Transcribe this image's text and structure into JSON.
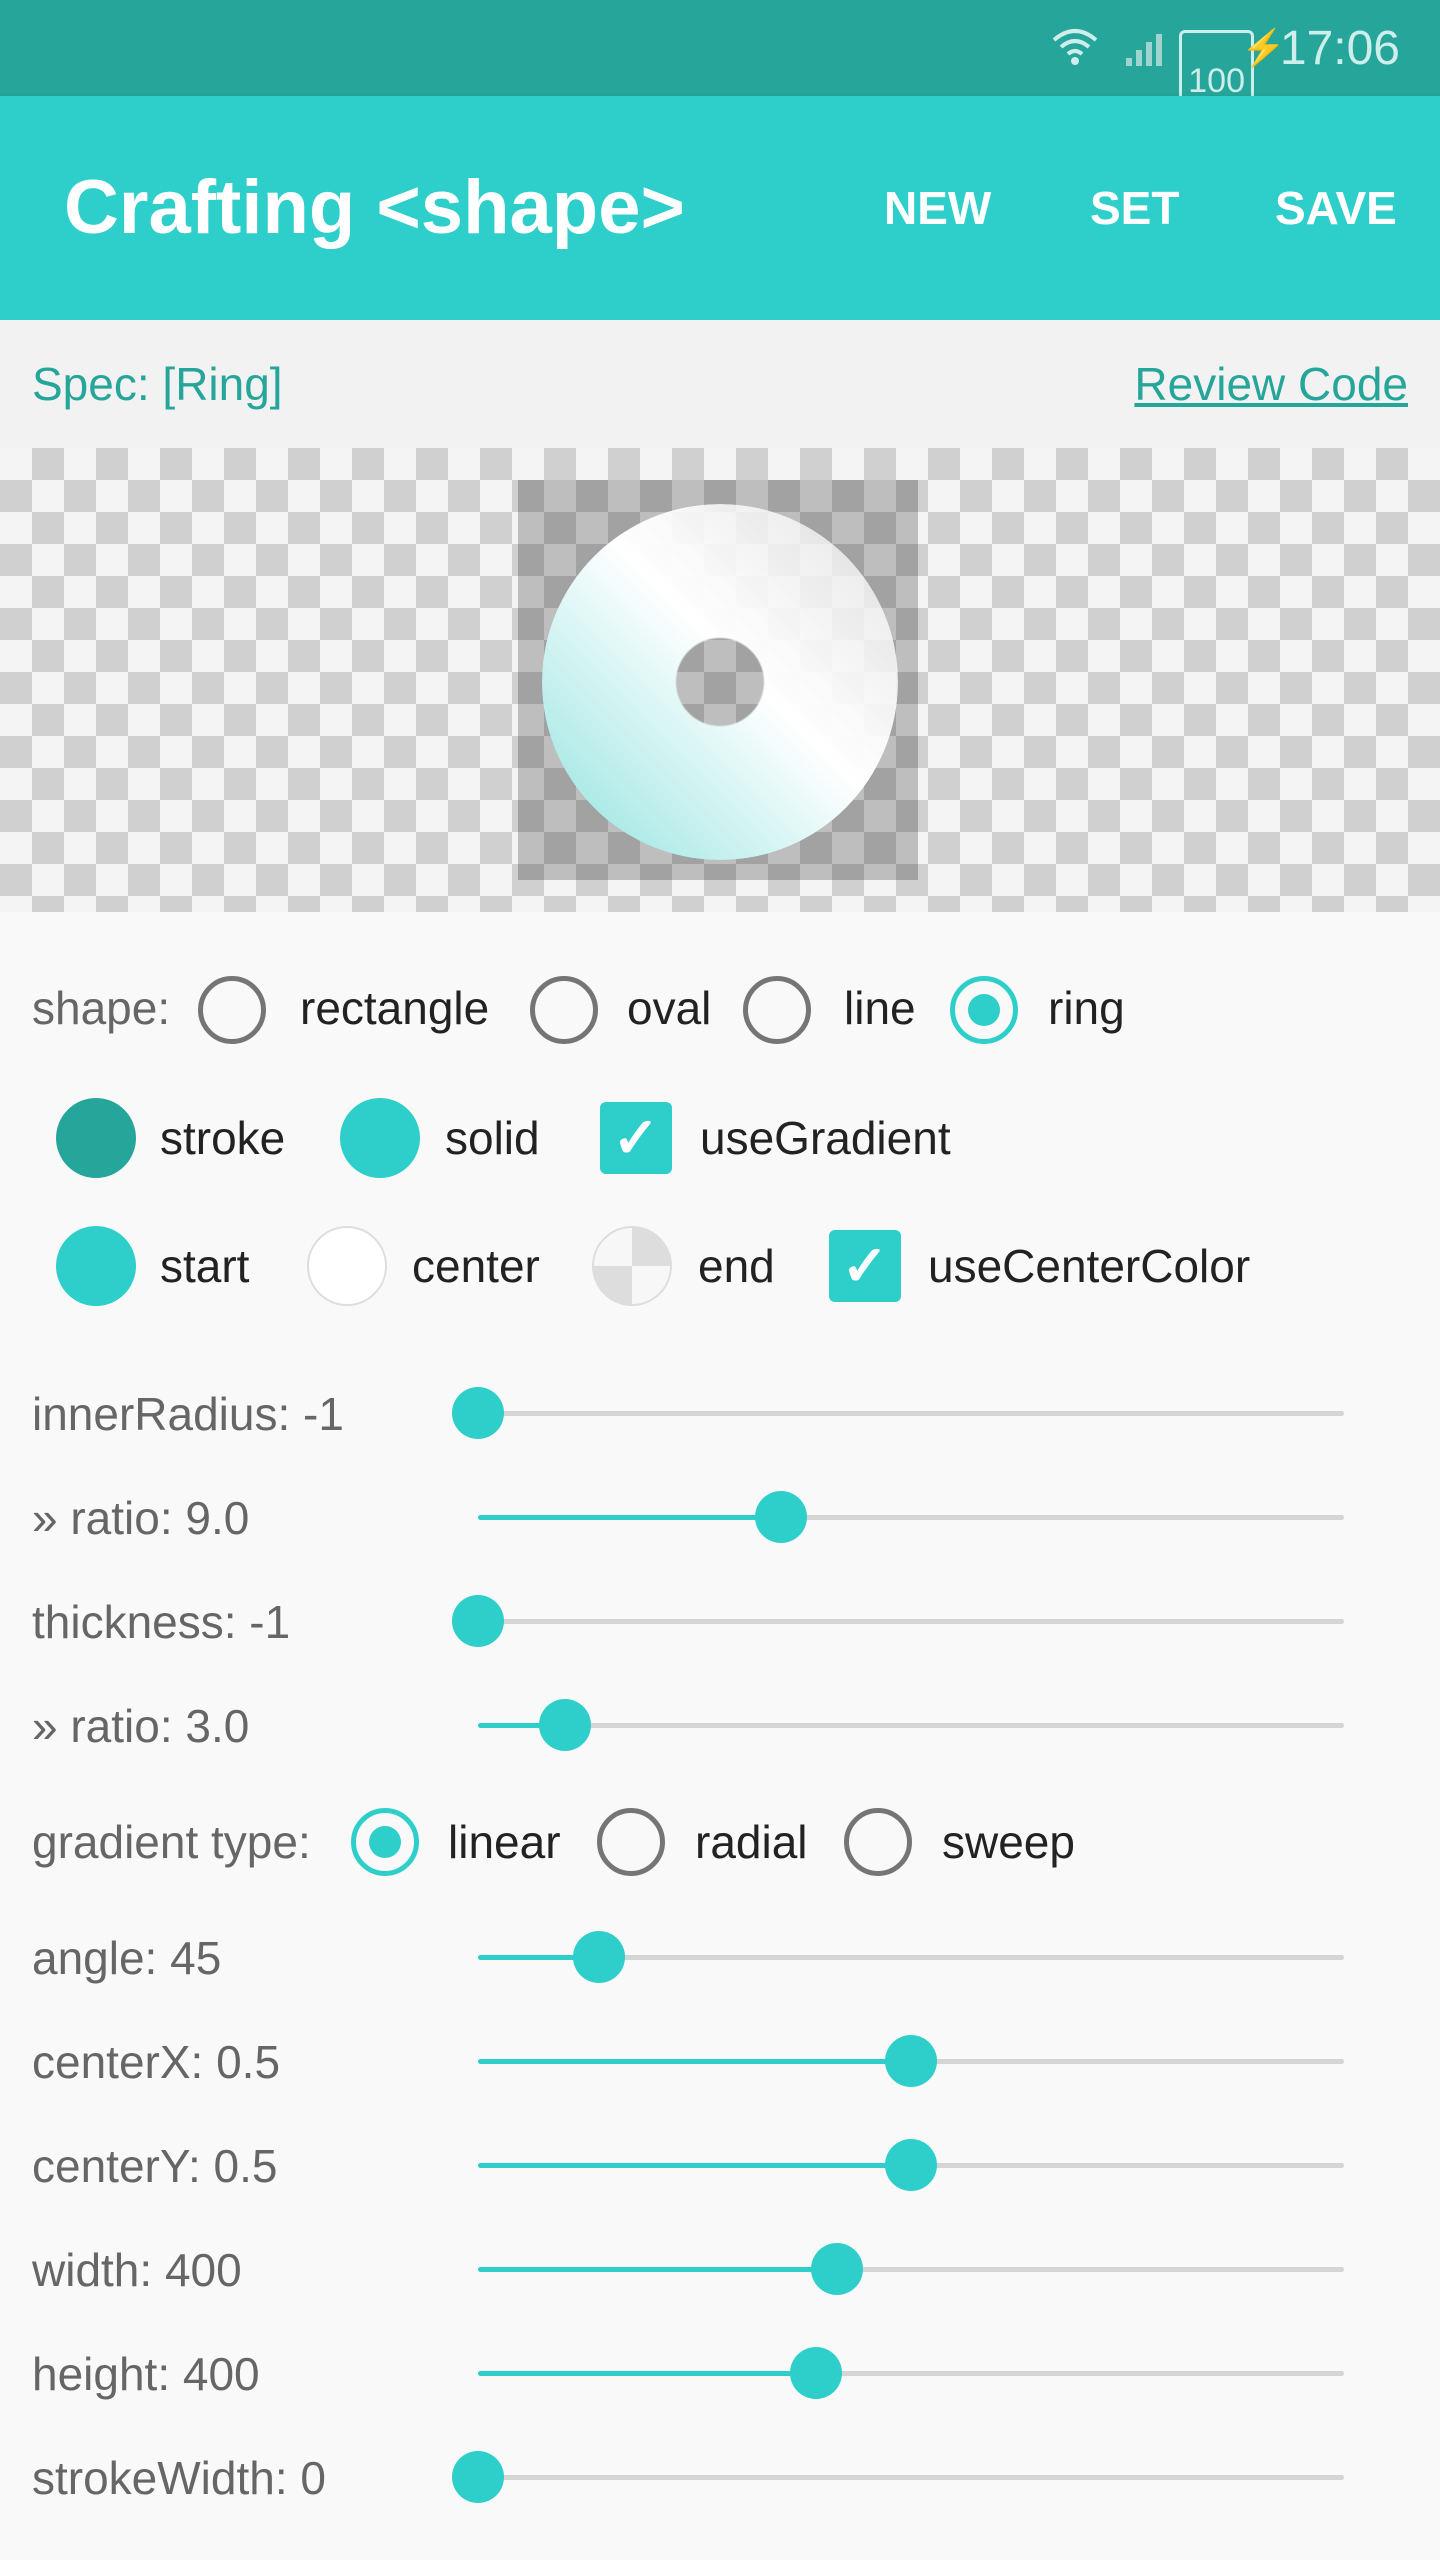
{
  "status_bar": {
    "wifi_icon": "wifi-icon",
    "signal_icon": "signal-icon",
    "battery": "100",
    "time": "17:06"
  },
  "app_bar": {
    "title": "Crafting <shape>",
    "actions": {
      "new": "NEW",
      "set": "SET",
      "save": "SAVE"
    }
  },
  "spec": {
    "label": "Spec: [Ring]",
    "review_code": "Review Code"
  },
  "shape": {
    "label": "shape:",
    "options": [
      "rectangle",
      "oval",
      "line",
      "ring"
    ],
    "selected": "ring"
  },
  "fill": {
    "stroke": {
      "label": "stroke",
      "color": "#26a69a"
    },
    "solid": {
      "label": "solid",
      "color": "#2ecfca"
    },
    "use_gradient": {
      "label": "useGradient",
      "checked": true
    }
  },
  "gradient_colors": {
    "start": {
      "label": "start",
      "color": "#2ecfca"
    },
    "center": {
      "label": "center",
      "color": "#ffffff"
    },
    "end": {
      "label": "end",
      "color": "transparent"
    },
    "use_center_color": {
      "label": "useCenterColor",
      "checked": true
    }
  },
  "sliders_top": [
    {
      "label": "innerRadius: -1",
      "fraction": 0.0
    },
    {
      "label": "» ratio: 9.0",
      "fraction": 0.35
    },
    {
      "label": "thickness: -1",
      "fraction": 0.0
    },
    {
      "label": "» ratio: 3.0",
      "fraction": 0.1
    }
  ],
  "gradient_type": {
    "label": "gradient type:",
    "options": [
      "linear",
      "radial",
      "sweep"
    ],
    "selected": "linear"
  },
  "sliders_bottom": [
    {
      "label": "angle: 45",
      "fraction": 0.14
    },
    {
      "label": "centerX: 0.5",
      "fraction": 0.5
    },
    {
      "label": "centerY: 0.5",
      "fraction": 0.5
    },
    {
      "label": "width: 400",
      "fraction": 0.415
    },
    {
      "label": "height: 400",
      "fraction": 0.39
    },
    {
      "label": "strokeWidth: 0",
      "fraction": 0.0
    }
  ],
  "colors": {
    "accent": "#2ecfca",
    "dark_accent": "#26a69a"
  }
}
